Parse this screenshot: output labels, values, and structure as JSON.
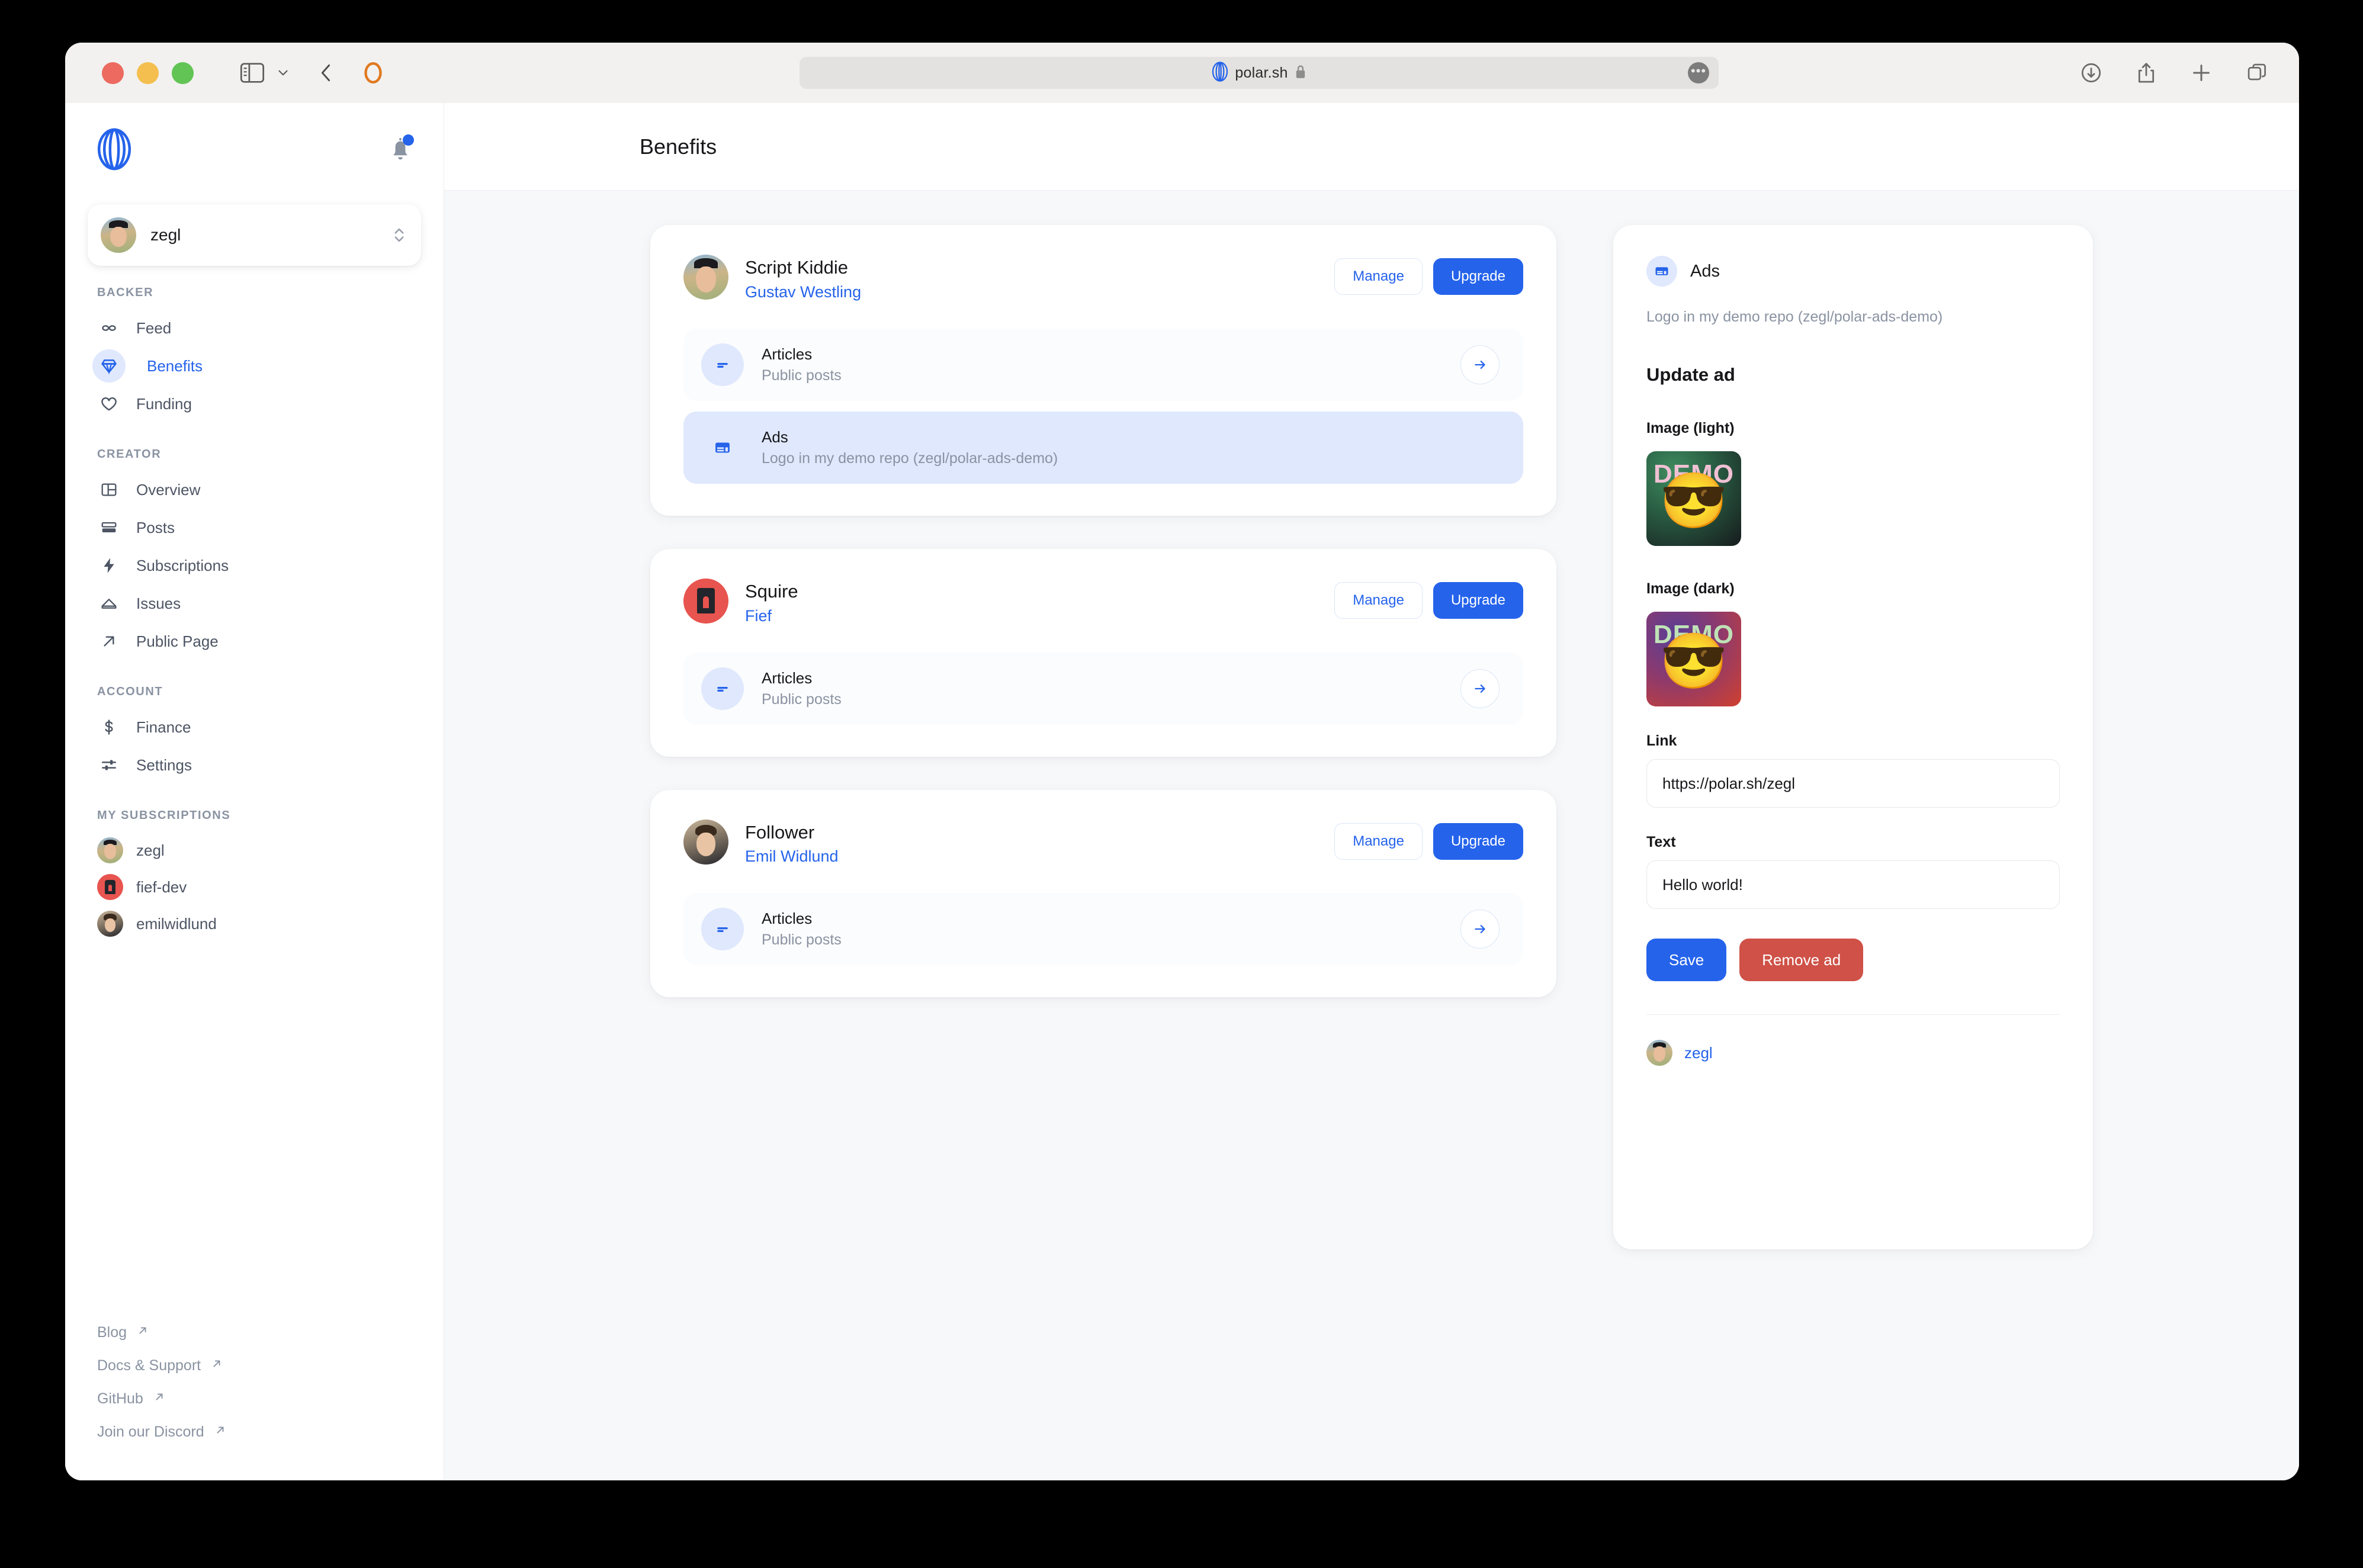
{
  "browser": {
    "address": "polar.sh",
    "icons": {
      "sidebar_toggle": "sidebar-toggle-icon",
      "chevron_down": "chevron-down-icon",
      "back": "back-chevron-icon",
      "reload": "reload-indicator-icon",
      "favicon": "polar-favicon-icon",
      "lock": "lock-icon",
      "more": "more-options-icon",
      "downloads": "downloads-icon",
      "share": "share-icon",
      "new_tab": "new-tab-icon",
      "tab_overview": "tab-overview-icon"
    }
  },
  "sidebar": {
    "logo": "polar-logo-icon",
    "notification_icon": "bell-icon",
    "org_switcher": {
      "name": "zegl",
      "chevrons_icon": "chevron-up-down-icon"
    },
    "sections": [
      {
        "title": "BACKER",
        "items": [
          {
            "label": "Feed",
            "icon": "infinity-icon",
            "active": false
          },
          {
            "label": "Benefits",
            "icon": "diamond-icon",
            "active": true
          },
          {
            "label": "Funding",
            "icon": "heart-icon",
            "active": false
          }
        ]
      },
      {
        "title": "CREATOR",
        "items": [
          {
            "label": "Overview",
            "icon": "layout-icon",
            "active": false
          },
          {
            "label": "Posts",
            "icon": "posts-icon",
            "active": false
          },
          {
            "label": "Subscriptions",
            "icon": "bolt-icon",
            "active": false
          },
          {
            "label": "Issues",
            "icon": "inbox-icon",
            "active": false
          },
          {
            "label": "Public Page",
            "icon": "arrow-up-right-icon",
            "active": false
          }
        ]
      },
      {
        "title": "ACCOUNT",
        "items": [
          {
            "label": "Finance",
            "icon": "dollar-icon",
            "active": false
          },
          {
            "label": "Settings",
            "icon": "sliders-icon",
            "active": false
          }
        ]
      }
    ],
    "subscriptions_title": "MY SUBSCRIPTIONS",
    "subscriptions": [
      {
        "label": "zegl",
        "avatar": "av-zegl"
      },
      {
        "label": "fief-dev",
        "avatar": "av-fief"
      },
      {
        "label": "emilwidlund",
        "avatar": "av-emil"
      }
    ],
    "footer_links": [
      {
        "label": "Blog",
        "icon": "external-link-icon"
      },
      {
        "label": "Docs & Support",
        "icon": "external-link-icon"
      },
      {
        "label": "GitHub",
        "icon": "external-link-icon"
      },
      {
        "label": "Join our Discord",
        "icon": "external-link-icon"
      }
    ]
  },
  "main": {
    "page_title": "Benefits",
    "cards": [
      {
        "tier": "Script Kiddie",
        "org": "Gustav Westling",
        "avatar": "av-zegl",
        "manage_label": "Manage",
        "upgrade_label": "Upgrade",
        "rows": [
          {
            "title": "Articles",
            "desc": "Public posts",
            "icon": "articles-icon",
            "selected": false,
            "arrow": "arrow-right-icon"
          },
          {
            "title": "Ads",
            "desc": "Logo in my demo repo (zegl/polar-ads-demo)",
            "icon": "ads-icon",
            "selected": true,
            "arrow": ""
          }
        ]
      },
      {
        "tier": "Squire",
        "org": "Fief",
        "avatar": "av-fief",
        "manage_label": "Manage",
        "upgrade_label": "Upgrade",
        "rows": [
          {
            "title": "Articles",
            "desc": "Public posts",
            "icon": "articles-icon",
            "selected": false,
            "arrow": "arrow-right-icon"
          }
        ]
      },
      {
        "tier": "Follower",
        "org": "Emil Widlund",
        "avatar": "av-emil",
        "manage_label": "Manage",
        "upgrade_label": "Upgrade",
        "rows": [
          {
            "title": "Articles",
            "desc": "Public posts",
            "icon": "articles-icon",
            "selected": false,
            "arrow": "arrow-right-icon"
          }
        ]
      }
    ]
  },
  "ads_panel": {
    "icon": "ads-icon",
    "title": "Ads",
    "description": "Logo in my demo repo (zegl/polar-ads-demo)",
    "update_title": "Update ad",
    "image_light_label": "Image (light)",
    "image_dark_label": "Image (dark)",
    "image_word": "DEMO",
    "image_emoji": "😎",
    "link_label": "Link",
    "link_value": "https://polar.sh/zegl",
    "text_label": "Text",
    "text_value": "Hello world!",
    "save_label": "Save",
    "remove_label": "Remove ad",
    "owner_name": "zegl",
    "owner_avatar": "av-zegl",
    "colors": {
      "accent": "#2563eb",
      "danger": "#cf5147",
      "highlight": "#dfe8fd"
    }
  }
}
